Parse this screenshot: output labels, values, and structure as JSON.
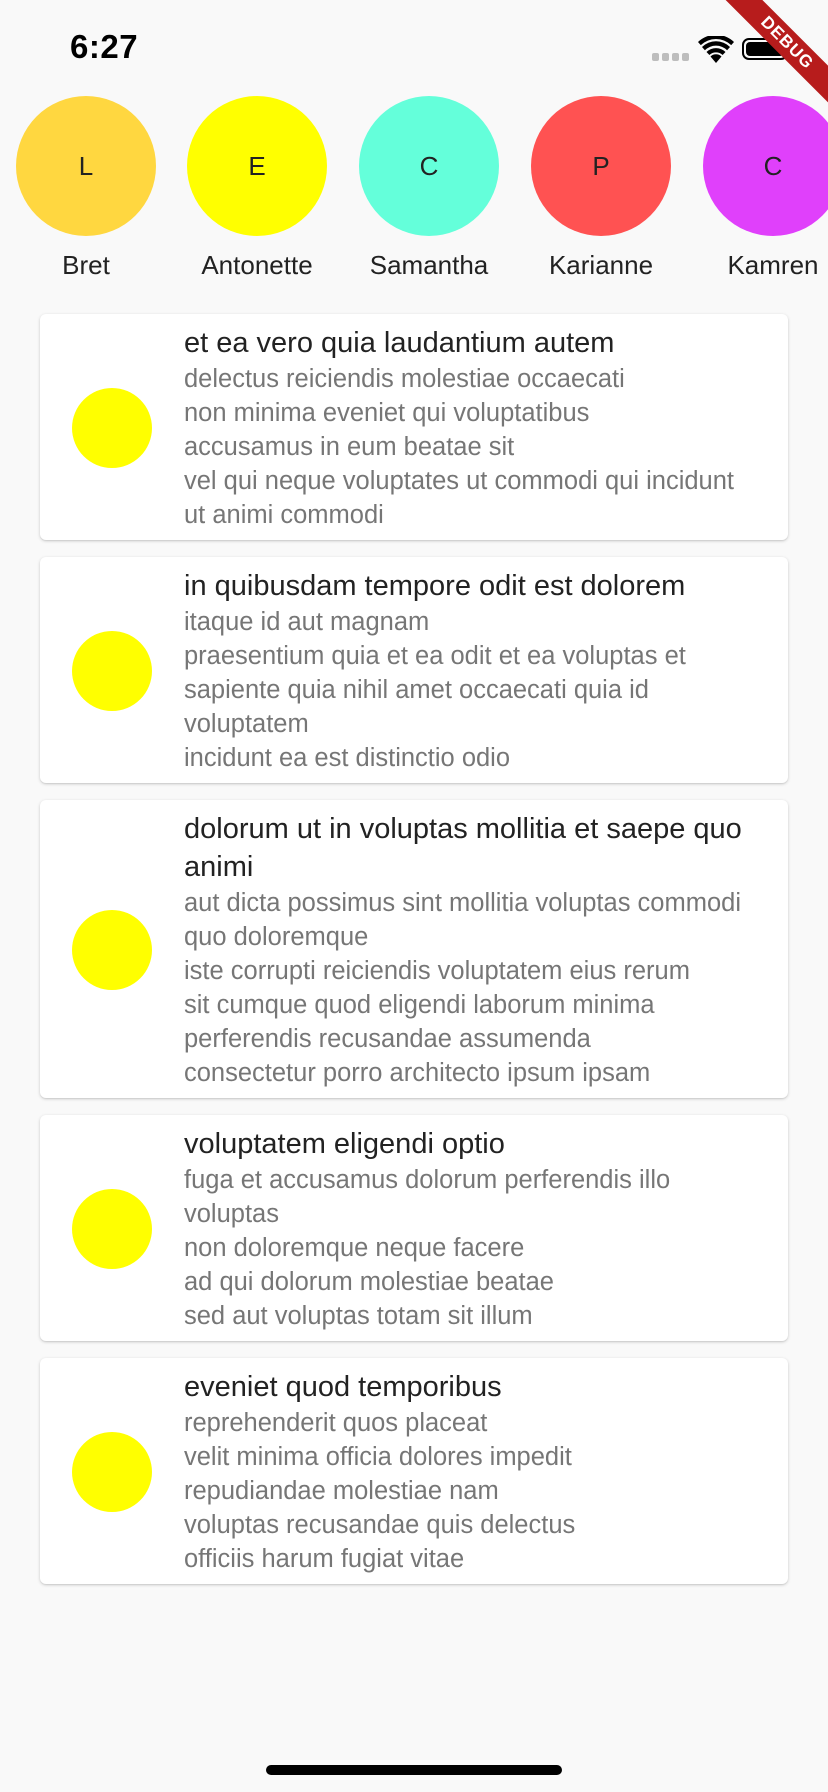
{
  "status_bar": {
    "time": "6:27",
    "debug_label": "DEBUG"
  },
  "colors": {
    "post_avatar": "#ffff00"
  },
  "stories": [
    {
      "initial": "L",
      "name": "Bret",
      "color": "#ffd740"
    },
    {
      "initial": "E",
      "name": "Antonette",
      "color": "#ffff00"
    },
    {
      "initial": "C",
      "name": "Samantha",
      "color": "#64ffda"
    },
    {
      "initial": "P",
      "name": "Karianne",
      "color": "#ff5252"
    },
    {
      "initial": "C",
      "name": "Kamren",
      "color": "#e040fb"
    }
  ],
  "posts": [
    {
      "title": "et ea vero quia laudantium autem",
      "body": "delectus reiciendis molestiae occaecati\nnon minima eveniet qui voluptatibus\naccusamus in eum beatae sit\nvel qui neque voluptates ut commodi qui incidunt\nut animi commodi"
    },
    {
      "title": "in quibusdam tempore odit est dolorem",
      "body": "itaque id aut magnam\npraesentium quia et ea odit et ea voluptas et\nsapiente quia nihil amet occaecati quia id voluptatem\nincidunt ea est distinctio odio"
    },
    {
      "title": "dolorum ut in voluptas mollitia et saepe quo animi",
      "body": "aut dicta possimus sint mollitia voluptas commodi quo doloremque\niste corrupti reiciendis voluptatem eius rerum\nsit cumque quod eligendi laborum minima\nperferendis recusandae assumenda\nconsectetur porro architecto ipsum ipsam"
    },
    {
      "title": "voluptatem eligendi optio",
      "body": "fuga et accusamus dolorum perferendis illo voluptas\nnon doloremque neque facere\nad qui dolorum molestiae beatae\nsed aut voluptas totam sit illum"
    },
    {
      "title": "eveniet quod temporibus",
      "body": "reprehenderit quos placeat\nvelit minima officia dolores impedit\nrepudiandae molestiae nam\nvoluptas recusandae quis delectus\nofficiis harum fugiat vitae"
    }
  ]
}
